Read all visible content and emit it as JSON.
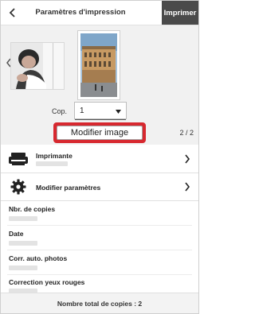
{
  "header": {
    "title": "Paramètres d'impression",
    "print_label": "Imprimer"
  },
  "preview": {
    "copies_label": "Cop.",
    "copies_value": "1",
    "modify_image_label": "Modifier image",
    "page_indicator": "2 / 2"
  },
  "rows": {
    "printer_label": "Imprimante",
    "settings_label": "Modifier paramètres"
  },
  "info": {
    "copies_label": "Nbr. de copies",
    "date_label": "Date",
    "auto_correct_label": "Corr. auto. photos",
    "red_eye_label": "Correction yeux rouges"
  },
  "footer": {
    "total_label": "Nombre total de copies : 2"
  },
  "colors": {
    "accent_red": "#d7282f",
    "print_button_bg": "#4a4a4a",
    "preview_bg": "#f1f1f1"
  },
  "icons": [
    "back-icon",
    "chevron-left-icon",
    "dropdown-arrow-icon",
    "printer-icon",
    "gear-icon",
    "chevron-right-icon"
  ]
}
